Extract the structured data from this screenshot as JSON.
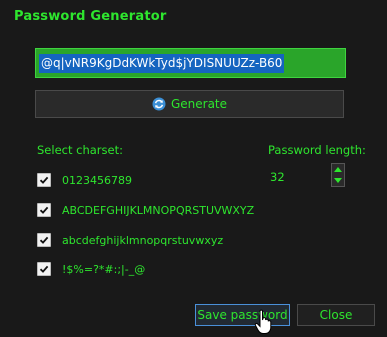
{
  "dialog": {
    "title": "Password Generator"
  },
  "password": {
    "value": "@q|vNR9KgDdKWkTyd$jYDISNUUZz-B60"
  },
  "generate": {
    "label": "Generate",
    "icon": "refresh-icon"
  },
  "charset": {
    "label": "Select charset:",
    "options": [
      {
        "label": "0123456789",
        "checked": true
      },
      {
        "label": "ABCDEFGHIJKLMNOPQRSTUVWXYZ",
        "checked": true
      },
      {
        "label": "abcdefghijklmnopqrstuvwxyz",
        "checked": true
      },
      {
        "label": "!$%=?*#:;|-_@",
        "checked": true
      }
    ]
  },
  "length": {
    "label": "Password length:",
    "value": "32"
  },
  "buttons": {
    "save": "Save password",
    "close": "Close"
  },
  "colors": {
    "accent": "#2ee62e",
    "background": "#191919",
    "selection": "#1565c0",
    "field": "#2aa52a"
  }
}
